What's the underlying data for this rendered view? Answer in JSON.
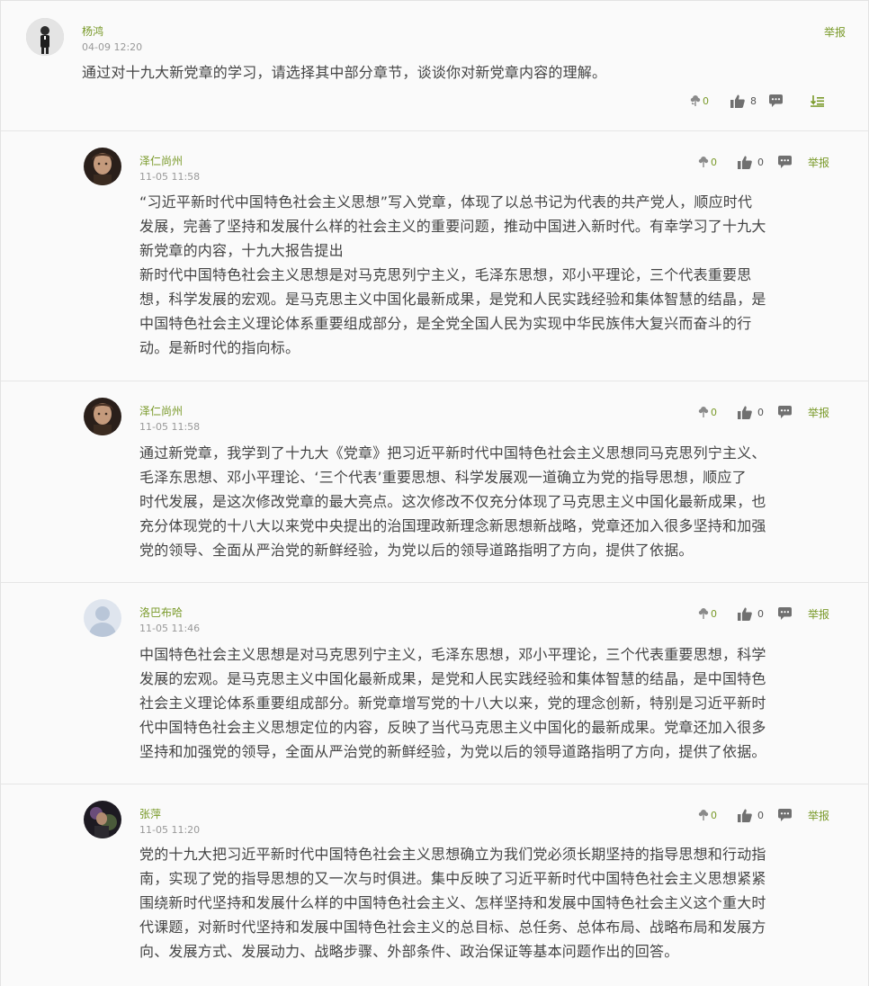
{
  "colors": {
    "accent": "#7a9a2a",
    "text": "#444444",
    "meta": "#999999",
    "icon": "#666666"
  },
  "question": {
    "author": "杨鸿",
    "time": "04-09 12:20",
    "text": "通过对十九大新党章的学习，请选择其中部分章节，谈谈你对新党章内容的理解。",
    "flowers": "0",
    "likes": "8",
    "report_label": "举报",
    "icons": [
      "flower-icon",
      "thumbs-up-icon",
      "comment-icon",
      "sort-icon"
    ]
  },
  "replies": [
    {
      "author": "泽仁尚州",
      "time": "11-05 11:58",
      "text_lines": [
        "“习近平新时代中国特色社会主义思想”写入党章，体现了以总书记为代表的共产党人，顺应时代",
        "发展，完善了坚持和发展什么样的社会主义的重要问题，推动中国进入新时代。有幸学习了十九大",
        "新党章的内容，十九大报告提出",
        "新时代中国特色社会主义思想是对马克思列宁主义，毛泽东思想，邓小平理论，三个代表重要思",
        "想，科学发展的宏观。是马克思主义中国化最新成果，是党和人民实践经验和集体智慧的结晶，是",
        "中国特色社会主义理论体系重要组成部分，是全党全国人民为实现中华民族伟大复兴而奋斗的行",
        "动。是新时代的指向标。"
      ],
      "flowers": "0",
      "likes": "0",
      "report_label": "举报"
    },
    {
      "author": "泽仁尚州",
      "time": "11-05 11:58",
      "text_lines": [
        "通过新党章，我学到了十九大《党章》把习近平新时代中国特色社会主义思想同马克思列宁主义、",
        "毛泽东思想、邓小平理论、‘三个代表’重要思想、科学发展观一道确立为党的指导思想，顺应了",
        "时代发展，是这次修改党章的最大亮点。这次修改不仅充分体现了马克思主义中国化最新成果，也",
        "充分体现党的十八大以来党中央提出的治国理政新理念新思想新战略，党章还加入很多坚持和加强",
        "党的领导、全面从严治党的新鲜经验，为党以后的领导道路指明了方向，提供了依据。"
      ],
      "flowers": "0",
      "likes": "0",
      "report_label": "举报"
    },
    {
      "author": "洛巴布哈",
      "time": "11-05 11:46",
      "text_lines": [
        "中国特色社会主义思想是对马克思列宁主义，毛泽东思想，邓小平理论，三个代表重要思想，科学",
        "发展的宏观。是马克思主义中国化最新成果，是党和人民实践经验和集体智慧的结晶，是中国特色",
        "社会主义理论体系重要组成部分。新党章增写党的十八大以来，党的理念创新，特别是习近平新时",
        "代中国特色社会主义思想定位的内容，反映了当代马克思主义中国化的最新成果。党章还加入很多",
        "坚持和加强党的领导，全面从严治党的新鲜经验，为党以后的领导道路指明了方向，提供了依据。"
      ],
      "flowers": "0",
      "likes": "0",
      "report_label": "举报"
    },
    {
      "author": "张萍",
      "time": "11-05 11:20",
      "text_lines": [
        "党的十九大把习近平新时代中国特色社会主义思想确立为我们党必须长期坚持的指导思想和行动指",
        "南，实现了党的指导思想的又一次与时俱进。集中反映了习近平新时代中国特色社会主义思想紧紧",
        "围绕新时代坚持和发展什么样的中国特色社会主义、怎样坚持和发展中国特色社会主义这个重大时",
        "代课题，对新时代坚持和发展中国特色社会主义的总目标、总任务、总体布局、战略布局和发展方",
        "向、发展方式、发展动力、战略步骤、外部条件、政治保证等基本问题作出的回答。"
      ],
      "flowers": "0",
      "likes": "0",
      "report_label": "举报"
    }
  ]
}
